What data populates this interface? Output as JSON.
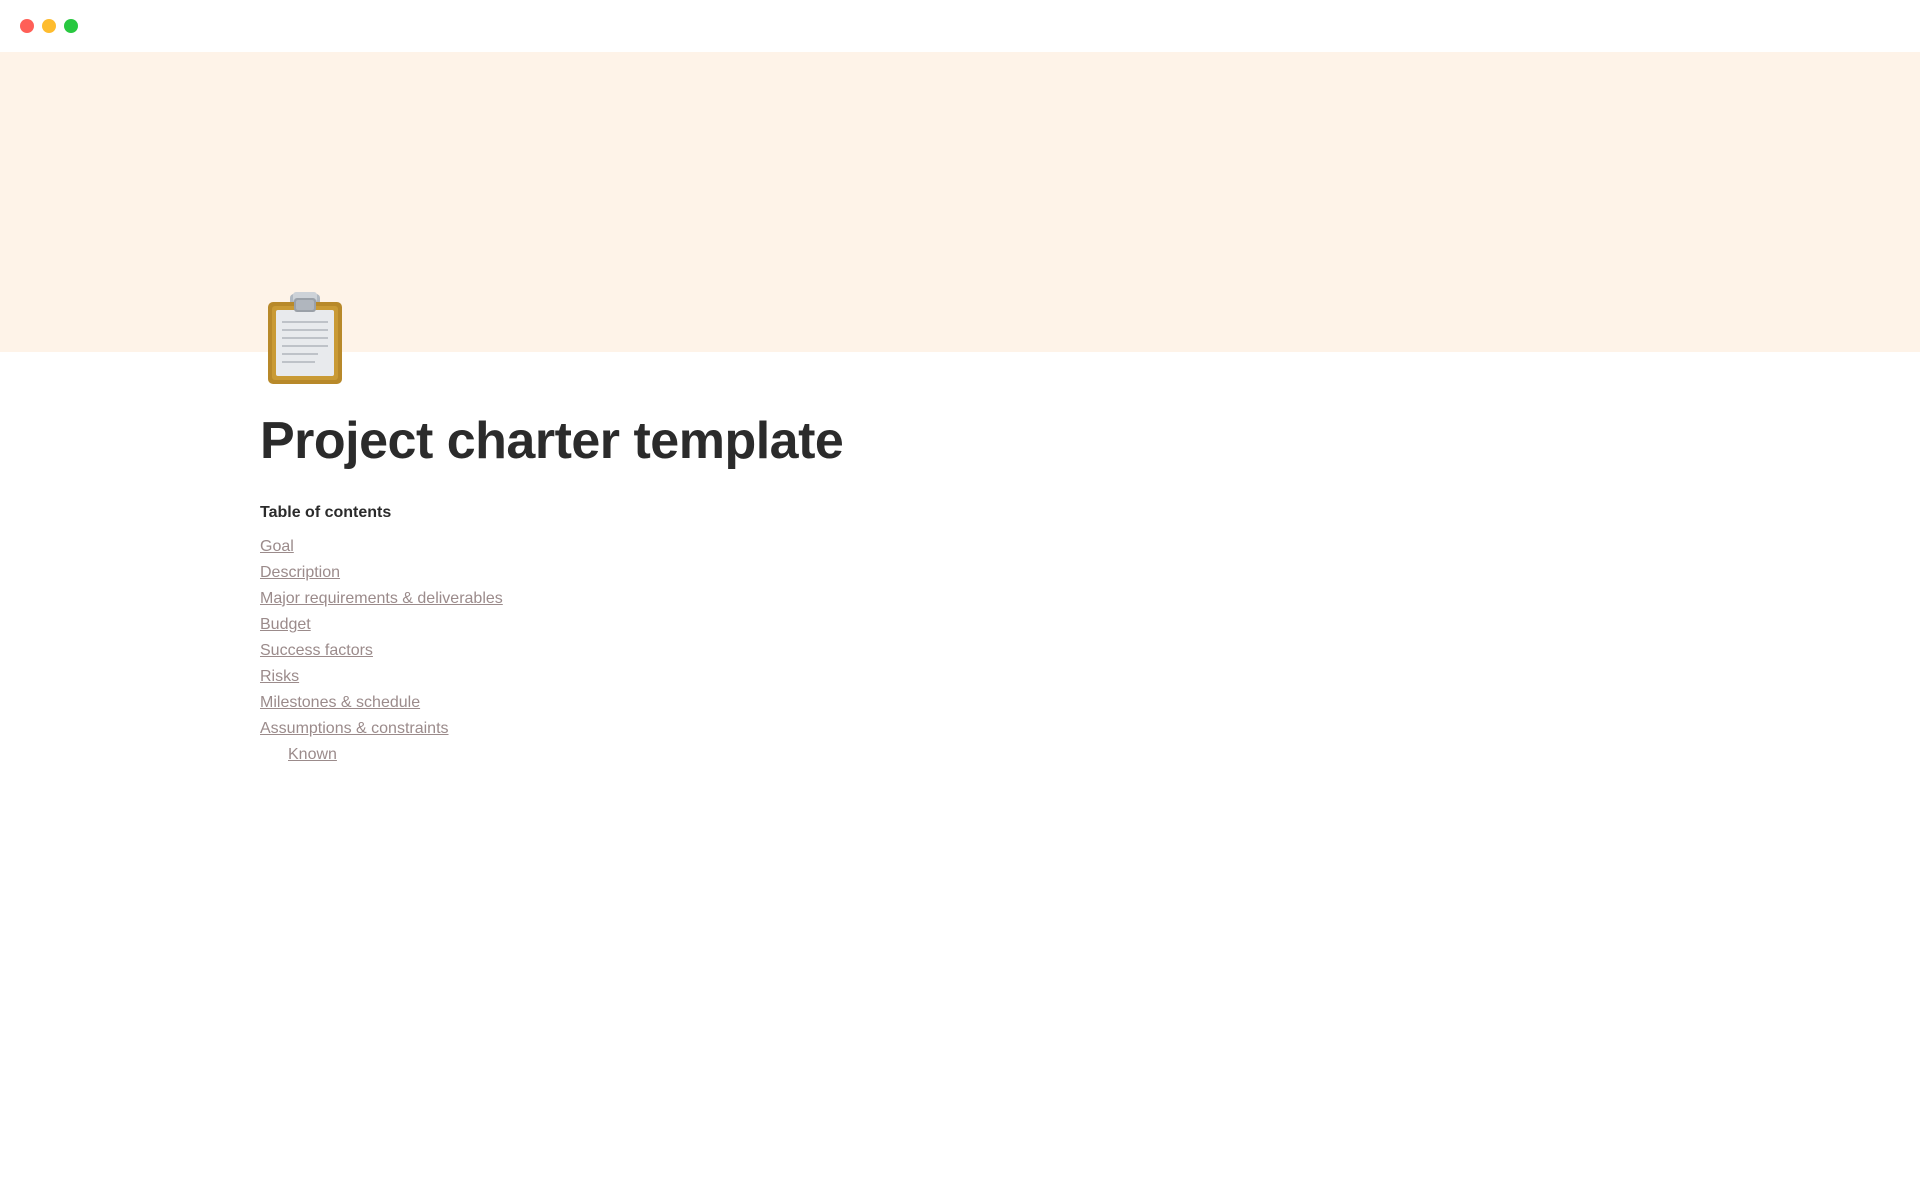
{
  "titlebar": {
    "traffic_close": "close",
    "traffic_minimize": "minimize",
    "traffic_maximize": "maximize"
  },
  "page": {
    "title": "Project charter template",
    "icon_alt": "clipboard"
  },
  "toc": {
    "heading": "Table of contents",
    "items": [
      {
        "label": "Goal",
        "indent": false
      },
      {
        "label": "Description",
        "indent": false
      },
      {
        "label": "Major requirements & deliverables",
        "indent": false
      },
      {
        "label": "Budget",
        "indent": false
      },
      {
        "label": "Success factors",
        "indent": false
      },
      {
        "label": "Risks",
        "indent": false
      },
      {
        "label": "Milestones & schedule",
        "indent": false
      },
      {
        "label": "Assumptions & constraints",
        "indent": false
      },
      {
        "label": "Known",
        "indent": true
      }
    ]
  }
}
